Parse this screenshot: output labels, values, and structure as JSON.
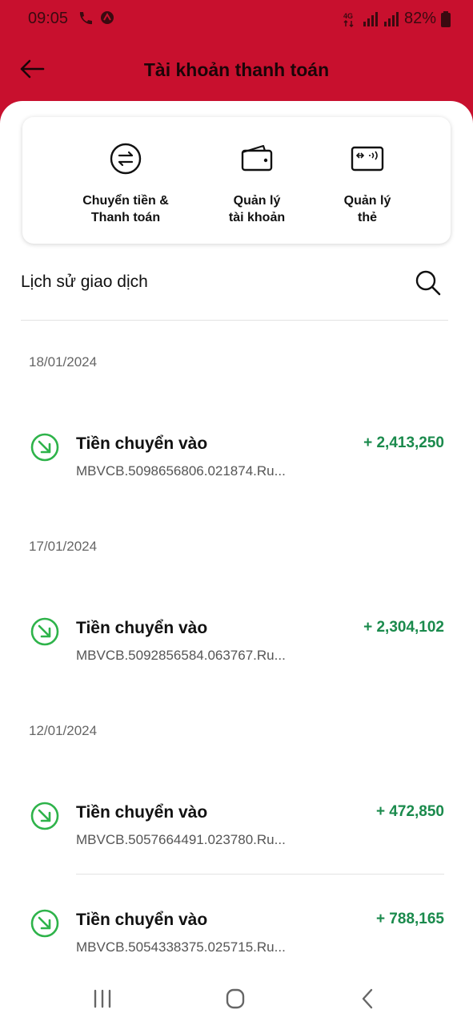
{
  "status_bar": {
    "time": "09:05",
    "battery": "82%",
    "network": "4G"
  },
  "header": {
    "title": "Tài khoản thanh toán"
  },
  "quick_actions": [
    {
      "label": "Chuyển tiền &\nThanh toán",
      "icon": "transfer-icon"
    },
    {
      "label": "Quản lý\ntài khoản",
      "icon": "wallet-icon"
    },
    {
      "label": "Quản lý\nthẻ",
      "icon": "card-icon"
    }
  ],
  "history": {
    "title": "Lịch sử giao dịch"
  },
  "transactions": [
    {
      "date": "18/01/2024",
      "title": "Tiền chuyển vào",
      "desc": "MBVCB.5098656806.021874.Ru...",
      "amount": "+ 2,413,250"
    },
    {
      "date": "17/01/2024",
      "title": "Tiền chuyển vào",
      "desc": "MBVCB.5092856584.063767.Ru...",
      "amount": "+ 2,304,102"
    },
    {
      "date": "12/01/2024",
      "title": "Tiền chuyển vào",
      "desc": "MBVCB.5057664491.023780.Ru...",
      "amount": "+ 472,850"
    },
    {
      "date": "",
      "title": "Tiền chuyển vào",
      "desc": "MBVCB.5054338375.025715.Ru...",
      "amount": "+ 788,165"
    }
  ],
  "colors": {
    "brand_red": "#c8102e",
    "income_green": "#1a8a4c",
    "icon_green": "#2eb34a"
  }
}
